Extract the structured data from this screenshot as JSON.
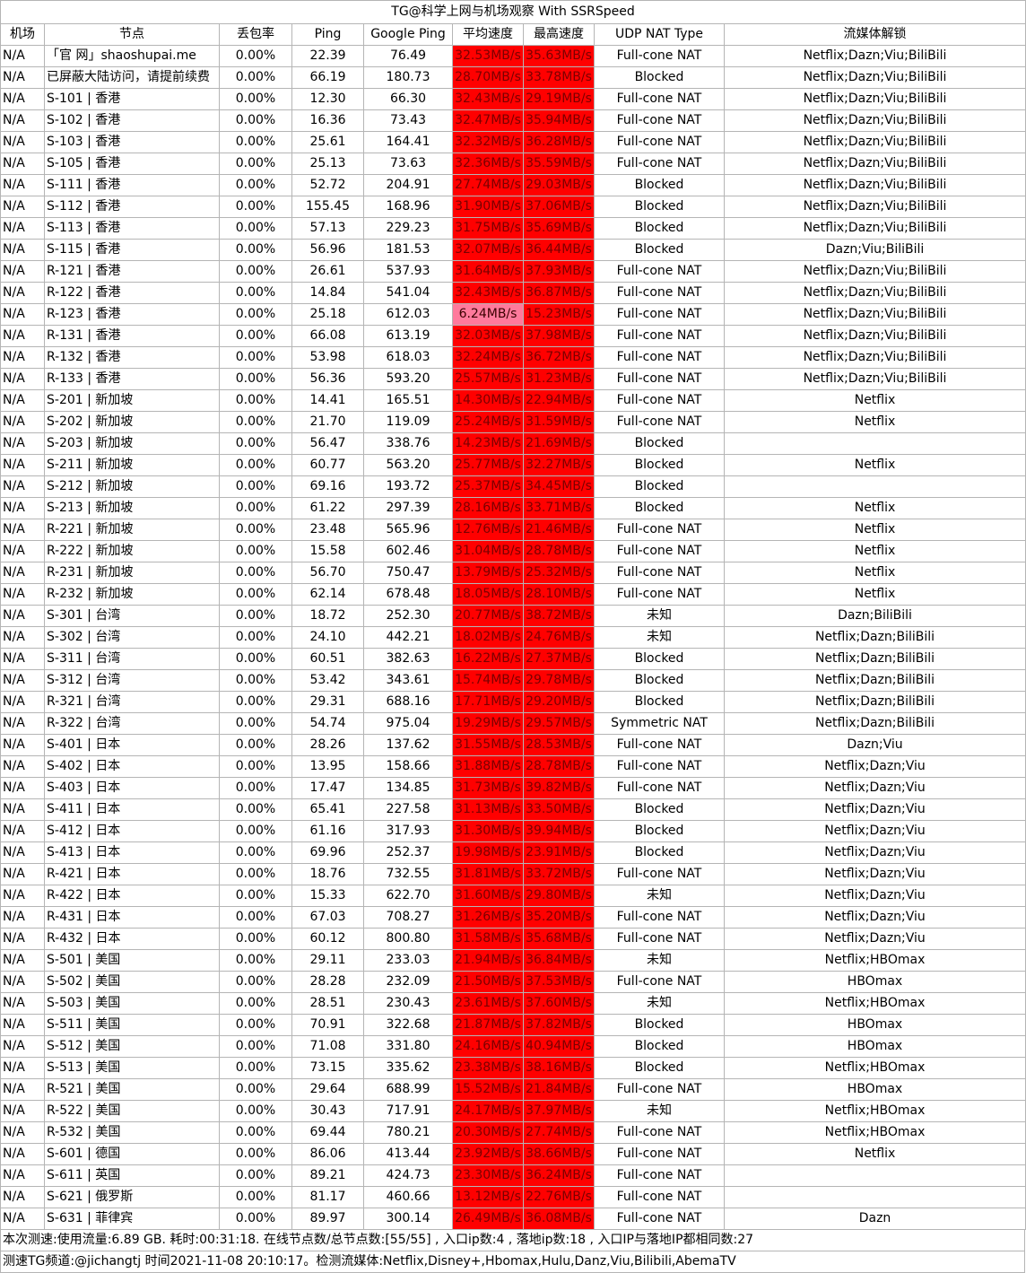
{
  "title": "TG@科学上网与机场观察 With SSRSpeed",
  "headers": [
    "机场",
    "节点",
    "丢包率",
    "Ping",
    "Google Ping",
    "平均速度",
    "最高速度",
    "UDP NAT Type",
    "流媒体解锁"
  ],
  "rows": [
    [
      "N/A",
      "「官 网」shaoshupai.me",
      "0.00%",
      "22.39",
      "76.49",
      "32.53MB/s",
      "35.63MB/s",
      "Full-cone NAT",
      "Netflix;Dazn;Viu;BiliBili"
    ],
    [
      "N/A",
      "已屏蔽大陆访问，请提前续费",
      "0.00%",
      "66.19",
      "180.73",
      "28.70MB/s",
      "33.78MB/s",
      "Blocked",
      "Netflix;Dazn;Viu;BiliBili"
    ],
    [
      "N/A",
      "S-101 | 香港",
      "0.00%",
      "12.30",
      "66.30",
      "32.43MB/s",
      "29.19MB/s",
      "Full-cone NAT",
      "Netflix;Dazn;Viu;BiliBili"
    ],
    [
      "N/A",
      "S-102 | 香港",
      "0.00%",
      "16.36",
      "73.43",
      "32.47MB/s",
      "35.94MB/s",
      "Full-cone NAT",
      "Netflix;Dazn;Viu;BiliBili"
    ],
    [
      "N/A",
      "S-103 | 香港",
      "0.00%",
      "25.61",
      "164.41",
      "32.32MB/s",
      "36.28MB/s",
      "Full-cone NAT",
      "Netflix;Dazn;Viu;BiliBili"
    ],
    [
      "N/A",
      "S-105 | 香港",
      "0.00%",
      "25.13",
      "73.63",
      "32.36MB/s",
      "35.59MB/s",
      "Full-cone NAT",
      "Netflix;Dazn;Viu;BiliBili"
    ],
    [
      "N/A",
      "S-111 | 香港",
      "0.00%",
      "52.72",
      "204.91",
      "27.74MB/s",
      "29.03MB/s",
      "Blocked",
      "Netflix;Dazn;Viu;BiliBili"
    ],
    [
      "N/A",
      "S-112 | 香港",
      "0.00%",
      "155.45",
      "168.96",
      "31.90MB/s",
      "37.06MB/s",
      "Blocked",
      "Netflix;Dazn;Viu;BiliBili"
    ],
    [
      "N/A",
      "S-113 | 香港",
      "0.00%",
      "57.13",
      "229.23",
      "31.75MB/s",
      "35.69MB/s",
      "Blocked",
      "Netflix;Dazn;Viu;BiliBili"
    ],
    [
      "N/A",
      "S-115 | 香港",
      "0.00%",
      "56.96",
      "181.53",
      "32.07MB/s",
      "36.44MB/s",
      "Blocked",
      "Dazn;Viu;BiliBili"
    ],
    [
      "N/A",
      "R-121 | 香港",
      "0.00%",
      "26.61",
      "537.93",
      "31.64MB/s",
      "37.93MB/s",
      "Full-cone NAT",
      "Netflix;Dazn;Viu;BiliBili"
    ],
    [
      "N/A",
      "R-122 | 香港",
      "0.00%",
      "14.84",
      "541.04",
      "32.43MB/s",
      "36.87MB/s",
      "Full-cone NAT",
      "Netflix;Dazn;Viu;BiliBili"
    ],
    [
      "N/A",
      "R-123 | 香港",
      "0.00%",
      "25.18",
      "612.03",
      "6.24MB/s",
      "15.23MB/s",
      "Full-cone NAT",
      "Netflix;Dazn;Viu;BiliBili"
    ],
    [
      "N/A",
      "R-131 | 香港",
      "0.00%",
      "66.08",
      "613.19",
      "32.03MB/s",
      "37.98MB/s",
      "Full-cone NAT",
      "Netflix;Dazn;Viu;BiliBili"
    ],
    [
      "N/A",
      "R-132 | 香港",
      "0.00%",
      "53.98",
      "618.03",
      "32.24MB/s",
      "36.72MB/s",
      "Full-cone NAT",
      "Netflix;Dazn;Viu;BiliBili"
    ],
    [
      "N/A",
      "R-133 | 香港",
      "0.00%",
      "56.36",
      "593.20",
      "25.57MB/s",
      "31.23MB/s",
      "Full-cone NAT",
      "Netflix;Dazn;Viu;BiliBili"
    ],
    [
      "N/A",
      "S-201 | 新加坡",
      "0.00%",
      "14.41",
      "165.51",
      "14.30MB/s",
      "22.94MB/s",
      "Full-cone NAT",
      "Netflix"
    ],
    [
      "N/A",
      "S-202 | 新加坡",
      "0.00%",
      "21.70",
      "119.09",
      "25.24MB/s",
      "31.59MB/s",
      "Full-cone NAT",
      "Netflix"
    ],
    [
      "N/A",
      "S-203 | 新加坡",
      "0.00%",
      "56.47",
      "338.76",
      "14.23MB/s",
      "21.69MB/s",
      "Blocked",
      ""
    ],
    [
      "N/A",
      "S-211 | 新加坡",
      "0.00%",
      "60.77",
      "563.20",
      "25.77MB/s",
      "32.27MB/s",
      "Blocked",
      "Netflix"
    ],
    [
      "N/A",
      "S-212 | 新加坡",
      "0.00%",
      "69.16",
      "193.72",
      "25.37MB/s",
      "34.45MB/s",
      "Blocked",
      ""
    ],
    [
      "N/A",
      "S-213 | 新加坡",
      "0.00%",
      "61.22",
      "297.39",
      "28.16MB/s",
      "33.71MB/s",
      "Blocked",
      "Netflix"
    ],
    [
      "N/A",
      "R-221 | 新加坡",
      "0.00%",
      "23.48",
      "565.96",
      "12.76MB/s",
      "21.46MB/s",
      "Full-cone NAT",
      "Netflix"
    ],
    [
      "N/A",
      "R-222 | 新加坡",
      "0.00%",
      "15.58",
      "602.46",
      "31.04MB/s",
      "28.78MB/s",
      "Full-cone NAT",
      "Netflix"
    ],
    [
      "N/A",
      "R-231 | 新加坡",
      "0.00%",
      "56.70",
      "750.47",
      "13.79MB/s",
      "25.32MB/s",
      "Full-cone NAT",
      "Netflix"
    ],
    [
      "N/A",
      "R-232 | 新加坡",
      "0.00%",
      "62.14",
      "678.48",
      "18.05MB/s",
      "28.10MB/s",
      "Full-cone NAT",
      "Netflix"
    ],
    [
      "N/A",
      "S-301 | 台湾",
      "0.00%",
      "18.72",
      "252.30",
      "20.77MB/s",
      "38.72MB/s",
      "未知",
      "Dazn;BiliBili"
    ],
    [
      "N/A",
      "S-302 | 台湾",
      "0.00%",
      "24.10",
      "442.21",
      "18.02MB/s",
      "24.76MB/s",
      "未知",
      "Netflix;Dazn;BiliBili"
    ],
    [
      "N/A",
      "S-311 | 台湾",
      "0.00%",
      "60.51",
      "382.63",
      "16.22MB/s",
      "27.37MB/s",
      "Blocked",
      "Netflix;Dazn;BiliBili"
    ],
    [
      "N/A",
      "S-312 | 台湾",
      "0.00%",
      "53.42",
      "343.61",
      "15.74MB/s",
      "29.78MB/s",
      "Blocked",
      "Netflix;Dazn;BiliBili"
    ],
    [
      "N/A",
      "R-321 | 台湾",
      "0.00%",
      "29.31",
      "688.16",
      "17.71MB/s",
      "29.20MB/s",
      "Blocked",
      "Netflix;Dazn;BiliBili"
    ],
    [
      "N/A",
      "R-322 | 台湾",
      "0.00%",
      "54.74",
      "975.04",
      "19.29MB/s",
      "29.57MB/s",
      "Symmetric NAT",
      "Netflix;Dazn;BiliBili"
    ],
    [
      "N/A",
      "S-401 | 日本",
      "0.00%",
      "28.26",
      "137.62",
      "31.55MB/s",
      "28.53MB/s",
      "Full-cone NAT",
      "Dazn;Viu"
    ],
    [
      "N/A",
      "S-402 | 日本",
      "0.00%",
      "13.95",
      "158.66",
      "31.88MB/s",
      "28.78MB/s",
      "Full-cone NAT",
      "Netflix;Dazn;Viu"
    ],
    [
      "N/A",
      "S-403 | 日本",
      "0.00%",
      "17.47",
      "134.85",
      "31.73MB/s",
      "39.82MB/s",
      "Full-cone NAT",
      "Netflix;Dazn;Viu"
    ],
    [
      "N/A",
      "S-411 | 日本",
      "0.00%",
      "65.41",
      "227.58",
      "31.13MB/s",
      "33.50MB/s",
      "Blocked",
      "Netflix;Dazn;Viu"
    ],
    [
      "N/A",
      "S-412 | 日本",
      "0.00%",
      "61.16",
      "317.93",
      "31.30MB/s",
      "39.94MB/s",
      "Blocked",
      "Netflix;Dazn;Viu"
    ],
    [
      "N/A",
      "S-413 | 日本",
      "0.00%",
      "69.96",
      "252.37",
      "19.98MB/s",
      "23.91MB/s",
      "Blocked",
      "Netflix;Dazn;Viu"
    ],
    [
      "N/A",
      "R-421 | 日本",
      "0.00%",
      "18.76",
      "732.55",
      "31.81MB/s",
      "33.72MB/s",
      "Full-cone NAT",
      "Netflix;Dazn;Viu"
    ],
    [
      "N/A",
      "R-422 | 日本",
      "0.00%",
      "15.33",
      "622.70",
      "31.60MB/s",
      "29.80MB/s",
      "未知",
      "Netflix;Dazn;Viu"
    ],
    [
      "N/A",
      "R-431 | 日本",
      "0.00%",
      "67.03",
      "708.27",
      "31.26MB/s",
      "35.20MB/s",
      "Full-cone NAT",
      "Netflix;Dazn;Viu"
    ],
    [
      "N/A",
      "R-432 | 日本",
      "0.00%",
      "60.12",
      "800.80",
      "31.58MB/s",
      "35.68MB/s",
      "Full-cone NAT",
      "Netflix;Dazn;Viu"
    ],
    [
      "N/A",
      "S-501 | 美国",
      "0.00%",
      "29.11",
      "233.03",
      "21.94MB/s",
      "36.84MB/s",
      "未知",
      "Netflix;HBOmax"
    ],
    [
      "N/A",
      "S-502 | 美国",
      "0.00%",
      "28.28",
      "232.09",
      "21.50MB/s",
      "37.53MB/s",
      "Full-cone NAT",
      "HBOmax"
    ],
    [
      "N/A",
      "S-503 | 美国",
      "0.00%",
      "28.51",
      "230.43",
      "23.61MB/s",
      "37.60MB/s",
      "未知",
      "Netflix;HBOmax"
    ],
    [
      "N/A",
      "S-511 | 美国",
      "0.00%",
      "70.91",
      "322.68",
      "21.87MB/s",
      "37.82MB/s",
      "Blocked",
      "HBOmax"
    ],
    [
      "N/A",
      "S-512 | 美国",
      "0.00%",
      "71.08",
      "331.80",
      "24.16MB/s",
      "40.94MB/s",
      "Blocked",
      "HBOmax"
    ],
    [
      "N/A",
      "S-513 | 美国",
      "0.00%",
      "73.15",
      "335.62",
      "23.38MB/s",
      "38.16MB/s",
      "Blocked",
      "Netflix;HBOmax"
    ],
    [
      "N/A",
      "R-521 | 美国",
      "0.00%",
      "29.64",
      "688.99",
      "15.52MB/s",
      "21.84MB/s",
      "Full-cone NAT",
      "HBOmax"
    ],
    [
      "N/A",
      "R-522 | 美国",
      "0.00%",
      "30.43",
      "717.91",
      "24.17MB/s",
      "37.97MB/s",
      "未知",
      "Netflix;HBOmax"
    ],
    [
      "N/A",
      "R-532 | 美国",
      "0.00%",
      "69.44",
      "780.21",
      "20.30MB/s",
      "27.74MB/s",
      "Full-cone NAT",
      "Netflix;HBOmax"
    ],
    [
      "N/A",
      "S-601 | 德国",
      "0.00%",
      "86.06",
      "413.44",
      "23.92MB/s",
      "38.66MB/s",
      "Full-cone NAT",
      "Netflix"
    ],
    [
      "N/A",
      "S-611 | 英国",
      "0.00%",
      "89.21",
      "424.73",
      "23.30MB/s",
      "36.24MB/s",
      "Full-cone NAT",
      ""
    ],
    [
      "N/A",
      "S-621 | 俄罗斯",
      "0.00%",
      "81.17",
      "460.66",
      "13.12MB/s",
      "22.76MB/s",
      "Full-cone NAT",
      ""
    ],
    [
      "N/A",
      "S-631 | 菲律宾",
      "0.00%",
      "89.97",
      "300.14",
      "26.49MB/s",
      "36.08MB/s",
      "Full-cone NAT",
      "Dazn"
    ]
  ],
  "footer": {
    "line1": "本次测速:使用流量:6.89 GB. 耗时:00:31:18. 在线节点数/总节点数:[55/55] , 入口ip数:4 , 落地ip数:18 , 入口IP与落地IP都相同数:27",
    "line2": "测速TG频道:@jichangtj 时间2021-11-08 20:10:17。检测流媒体:Netflix,Disney+,Hbomax,Hulu,Danz,Viu,Bilibili,AbemaTV"
  },
  "colors": {
    "speed_fast": "#ff0000",
    "speed_slow": "#ff7a9c",
    "grid": "#b5b5b5"
  }
}
